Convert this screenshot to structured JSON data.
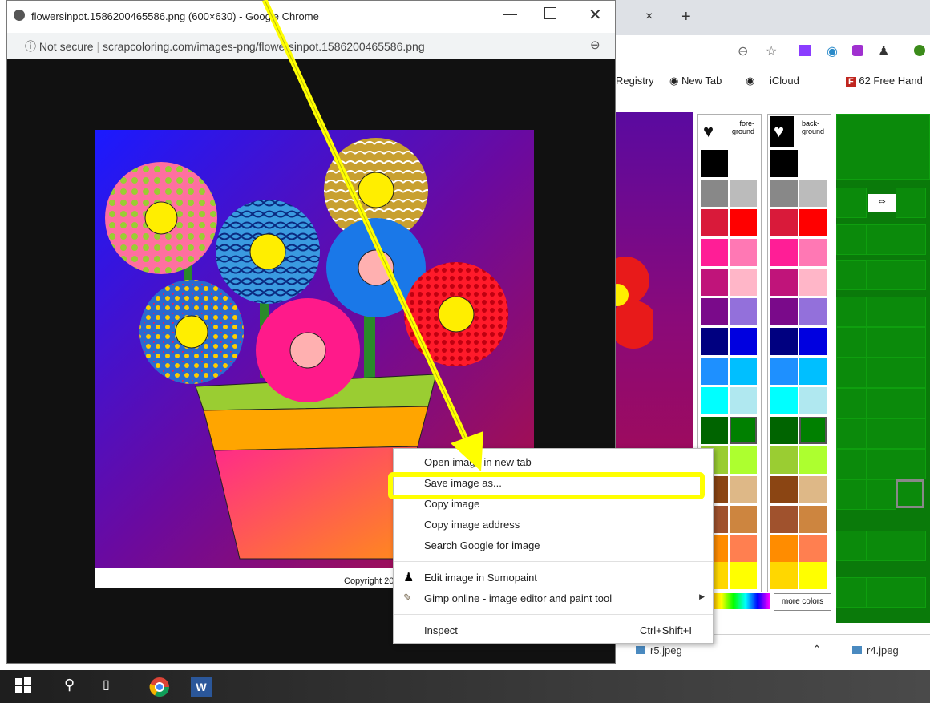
{
  "popup": {
    "title": "flowersinpot.1586200465586.png (600×630) - Google Chrome",
    "url_info": "ⓘ",
    "url_not_secure": "Not secure",
    "url": "scrapcoloring.com/images-png/flowersinpot.1586200465586.png",
    "image_copyright": "Copyright 20"
  },
  "background": {
    "tab_close": "×",
    "new_tab": "+",
    "bookmarks": [
      "Registry",
      "New Tab",
      "iCloud",
      "62 Free Hand"
    ],
    "palette_fore_label": "fore-\nground",
    "palette_back_label": "back-\nground",
    "more_colors": "more colors",
    "downloads": [
      "r5.jpeg",
      "r4.jpeg"
    ]
  },
  "context_menu": {
    "items": [
      {
        "label": "Open image in new tab"
      },
      {
        "label": "Save image as..."
      },
      {
        "label": "Copy image"
      },
      {
        "label": "Copy image address"
      },
      {
        "label": "Search Google for image"
      },
      {
        "label": "Edit image in Sumopaint"
      },
      {
        "label": "Gimp online - image editor and paint tool"
      },
      {
        "label": "Inspect",
        "shortcut": "Ctrl+Shift+I"
      }
    ]
  },
  "colors": {
    "highlight": "#ffff00",
    "pattern_green": "#0a7a0a"
  }
}
